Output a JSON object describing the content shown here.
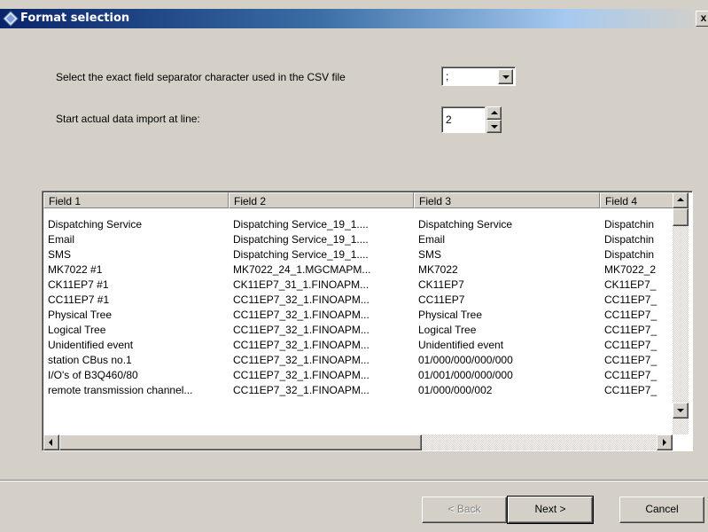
{
  "window": {
    "title": "Format selection",
    "close_label": "x"
  },
  "separator": {
    "label": "Select the exact field separator character used in the CSV file",
    "value": ";"
  },
  "start_line": {
    "label": "Start actual data import at line:",
    "value": "2"
  },
  "grid": {
    "columns": [
      "Field 1",
      "Field 2",
      "Field 3",
      "Field 4"
    ],
    "rows": [
      [
        "Dispatching Service",
        "Dispatching Service_19_1....",
        "Dispatching Service",
        "Dispatchin"
      ],
      [
        "Email",
        "Dispatching Service_19_1....",
        "Email",
        "Dispatchin"
      ],
      [
        "SMS",
        "Dispatching Service_19_1....",
        "SMS",
        "Dispatchin"
      ],
      [
        "MK7022 #1",
        "MK7022_24_1.MGCMAPM...",
        "MK7022",
        "MK7022_2"
      ],
      [
        "CK11EP7 #1",
        "CK11EP7_31_1.FINOAPM...",
        "CK11EP7",
        "CK11EP7_"
      ],
      [
        "CC11EP7 #1",
        "CC11EP7_32_1.FINOAPM...",
        "CC11EP7",
        "CC11EP7_"
      ],
      [
        "Physical Tree",
        "CC11EP7_32_1.FINOAPM...",
        "Physical Tree",
        "CC11EP7_"
      ],
      [
        "Logical Tree",
        "CC11EP7_32_1.FINOAPM...",
        "Logical Tree",
        "CC11EP7_"
      ],
      [
        "Unidentified event",
        "CC11EP7_32_1.FINOAPM...",
        "Unidentified event",
        "CC11EP7_"
      ],
      [
        "station CBus no.1",
        "CC11EP7_32_1.FINOAPM...",
        "01/000/000/000/000",
        "CC11EP7_"
      ],
      [
        "I/O's of B3Q460/80",
        "CC11EP7_32_1.FINOAPM...",
        "01/001/000/000/000",
        "CC11EP7_"
      ],
      [
        "remote transmission channel...",
        "CC11EP7_32_1.FINOAPM...",
        "01/000/000/002",
        "CC11EP7_"
      ]
    ]
  },
  "buttons": {
    "back": "< Back",
    "next": "Next >",
    "cancel": "Cancel"
  }
}
